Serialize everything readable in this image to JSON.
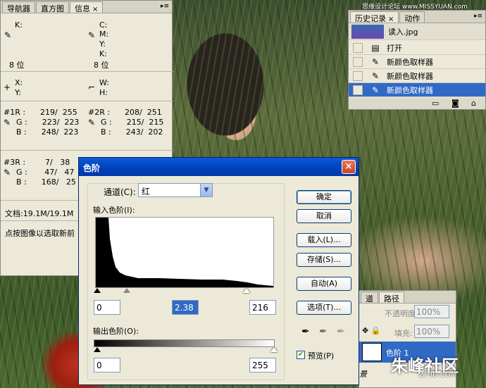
{
  "watermark_top": "思缘设计论坛 www.MISSYUAN.com",
  "watermark_bottom": "朱峰社区",
  "watermark_bottom_sub": "ZF3D.COM",
  "info_panel": {
    "tabs": [
      "导航器",
      "直方图",
      "信息"
    ],
    "close": "×",
    "rows": {
      "k1_label": "K:",
      "c_label": "C:",
      "m_label": "M:",
      "y_label": "Y:",
      "k2_label": "K:",
      "bits_left": "8 位",
      "bits_right": "8 位",
      "x_label": "X:",
      "y2_label": "Y:",
      "w_label": "W:",
      "h_label": "H:",
      "s1_r": "#1R :      219/  255",
      "s1_g": "G :      223/  223",
      "s1_b": "B :      248/  223",
      "s2_r": "#2R :      208/  251",
      "s2_g": "G :      215/  215",
      "s2_b": "B :      243/  202",
      "s3_r": "#3R :        7/   38",
      "s3_g": "G :       47/   47",
      "s3_b": "B :      168/   25",
      "doc": "文档:19.1M/19.1M",
      "hint": "点按图像以选取新前"
    }
  },
  "history_panel": {
    "tabs": [
      "历史记录",
      "动作"
    ],
    "close": "×",
    "snapshot_label": "读入.jpg",
    "items": [
      {
        "label": "打开",
        "icon": "document-icon"
      },
      {
        "label": "新颜色取样器",
        "icon": "color-sampler-icon"
      },
      {
        "label": "新颜色取样器",
        "icon": "color-sampler-icon"
      },
      {
        "label": "新颜色取样器",
        "icon": "color-sampler-icon",
        "selected": true
      }
    ]
  },
  "levels_dialog": {
    "title": "色阶",
    "close": "×",
    "channel_label": "通道(C):",
    "channel_value": "红",
    "input_label": "输入色阶(I):",
    "input_black": "0",
    "input_gamma": "2.38",
    "input_white": "216",
    "output_label": "输出色阶(O):",
    "output_black": "0",
    "output_white": "255",
    "buttons": {
      "ok": "确定",
      "cancel": "取消",
      "load": "载入(L)...",
      "save": "存储(S)...",
      "auto": "自动(A)",
      "options": "选项(T)..."
    },
    "preview_label": "预览(P)",
    "preview_checked": true
  },
  "layers_panel": {
    "tabs": [
      "道",
      "路径"
    ],
    "opacity_label": "不透明度:",
    "opacity_value": "100%",
    "fill_label": "填充:",
    "fill_value": "100%",
    "layer_name": "色阶 1",
    "bg_label": "景"
  }
}
